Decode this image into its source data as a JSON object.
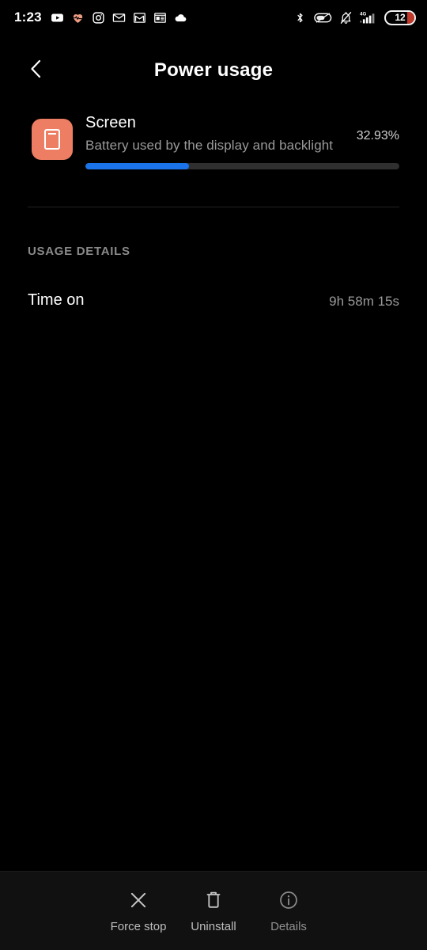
{
  "status_bar": {
    "time": "1:23",
    "left_icons": [
      {
        "name": "youtube-icon"
      },
      {
        "name": "heart-rate-icon"
      },
      {
        "name": "instagram-icon"
      },
      {
        "name": "mail-icon"
      },
      {
        "name": "gmail-icon"
      },
      {
        "name": "news-icon"
      },
      {
        "name": "cloud-icon"
      }
    ],
    "right_icons": [
      {
        "name": "bluetooth-icon"
      },
      {
        "name": "alarm-off-icon"
      },
      {
        "name": "notifications-muted-icon"
      },
      {
        "name": "signal-4g-icon"
      }
    ],
    "network_type": "4G",
    "battery_level": "12"
  },
  "appbar": {
    "back_icon": "back-chevron-icon",
    "title": "Power usage"
  },
  "summary": {
    "icon_name": "screen-app-icon",
    "icon_color": "#ED7E63",
    "title": "Screen",
    "subtitle": "Battery used by the display and backlight",
    "percent_label": "32.93%",
    "progress_percent": 32.93,
    "progress_color": "#1A73E8"
  },
  "usage_details": {
    "header": "USAGE DETAILS",
    "rows": [
      {
        "label": "Time on",
        "value": "9h 58m 15s"
      }
    ]
  },
  "bottom_actions": [
    {
      "icon": "close-icon",
      "label": "Force stop"
    },
    {
      "icon": "trash-icon",
      "label": "Uninstall"
    },
    {
      "icon": "info-icon",
      "label": "Details"
    }
  ]
}
